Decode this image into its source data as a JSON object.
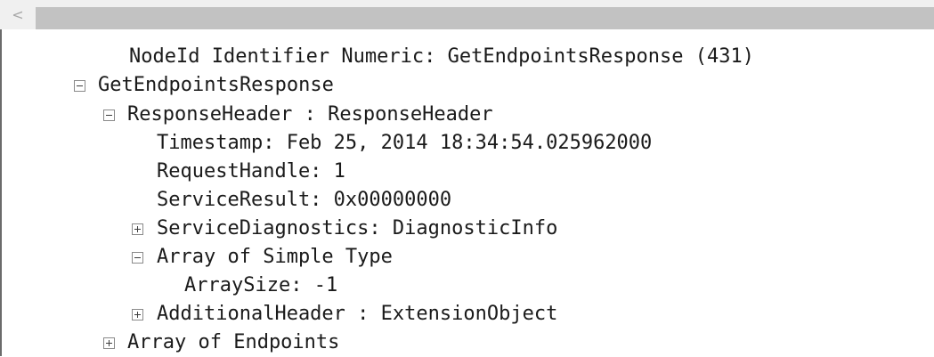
{
  "scrollbar": {
    "left_arrow": "<"
  },
  "tree": {
    "rows": [
      {
        "text": "NodeId Identifier Numeric: GetEndpointsResponse (431)",
        "expander": "none"
      },
      {
        "text": "GetEndpointsResponse",
        "expander": "minus"
      },
      {
        "text": "ResponseHeader : ResponseHeader",
        "expander": "minus"
      },
      {
        "text": "Timestamp: Feb 25, 2014 18:34:54.025962000",
        "expander": "none"
      },
      {
        "text": "RequestHandle: 1",
        "expander": "none"
      },
      {
        "text": "ServiceResult: 0x00000000",
        "expander": "none"
      },
      {
        "text": "ServiceDiagnostics: DiagnosticInfo",
        "expander": "plus"
      },
      {
        "text": "Array of Simple Type",
        "expander": "minus"
      },
      {
        "text": "ArraySize: -1",
        "expander": "none"
      },
      {
        "text": "AdditionalHeader : ExtensionObject",
        "expander": "plus"
      },
      {
        "text": "Array of Endpoints",
        "expander": "plus"
      }
    ]
  }
}
